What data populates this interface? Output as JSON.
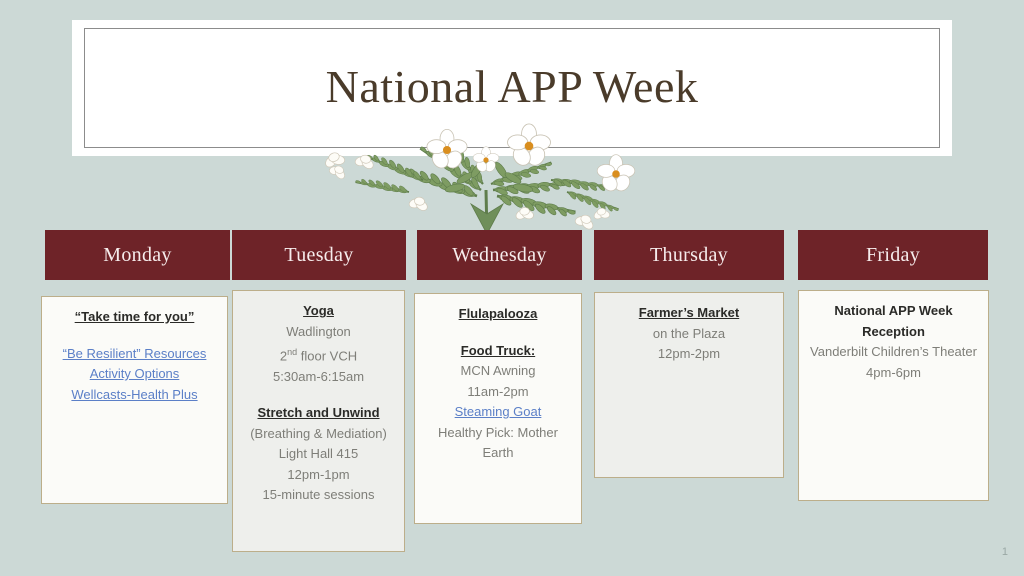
{
  "slide": {
    "title": "National APP Week",
    "page_number": "1",
    "background_color": "#ccd9d6",
    "header_color": "#6e2328",
    "link_color": "#5b7fc7",
    "card_border_color": "#bcae8a",
    "title_color": "#4a3b2a"
  },
  "decoration": {
    "name": "floral-botanical-illustration",
    "flower_petal_color": "#ffffff",
    "flower_center_color": "#d98e1f",
    "foliage_color": "#6f8f5a"
  },
  "days": [
    {
      "name": "Monday",
      "card_style": "white",
      "lines": [
        {
          "text": "“Take time for you”",
          "style": "head"
        },
        {
          "text": "",
          "style": "gap"
        },
        {
          "text": "“Be Resilient” Resources",
          "style": "link"
        },
        {
          "text": "Activity Options",
          "style": "link"
        },
        {
          "text": "Wellcasts-Health Plus",
          "style": "link"
        }
      ]
    },
    {
      "name": "Tuesday",
      "card_style": "gray",
      "lines": [
        {
          "text": "Yoga",
          "style": "head"
        },
        {
          "text": "Wadlington",
          "style": "body"
        },
        {
          "text": "2nd floor VCH",
          "style": "body-sup",
          "sup_base": "2",
          "sup_text": "nd",
          "sup_tail": " floor VCH"
        },
        {
          "text": "5:30am-6:15am",
          "style": "body"
        },
        {
          "text": "",
          "style": "gap"
        },
        {
          "text": "Stretch and Unwind",
          "style": "head"
        },
        {
          "text": "(Breathing & Mediation)",
          "style": "body"
        },
        {
          "text": "Light Hall 415",
          "style": "body"
        },
        {
          "text": "12pm-1pm",
          "style": "body"
        },
        {
          "text": "15-minute sessions",
          "style": "body"
        }
      ]
    },
    {
      "name": "Wednesday",
      "card_style": "white",
      "lines": [
        {
          "text": "Flulapalooza",
          "style": "head"
        },
        {
          "text": "",
          "style": "gap"
        },
        {
          "text": "Food Truck:",
          "style": "head"
        },
        {
          "text": "MCN Awning",
          "style": "body"
        },
        {
          "text": "11am-2pm",
          "style": "body"
        },
        {
          "text": "Steaming Goat",
          "style": "link"
        },
        {
          "text": "Healthy Pick: Mother Earth",
          "style": "body-wrap"
        }
      ]
    },
    {
      "name": "Thursday",
      "card_style": "gray",
      "lines": [
        {
          "text": "Farmer’s Market",
          "style": "head"
        },
        {
          "text": "on the Plaza",
          "style": "body"
        },
        {
          "text": "12pm-2pm",
          "style": "body"
        }
      ]
    },
    {
      "name": "Friday",
      "card_style": "white",
      "lines": [
        {
          "text": "National APP Week Reception",
          "style": "head-plain-wrap"
        },
        {
          "text": "Vanderbilt Children’s Theater",
          "style": "body-wrap"
        },
        {
          "text": "4pm-6pm",
          "style": "body"
        }
      ]
    }
  ]
}
